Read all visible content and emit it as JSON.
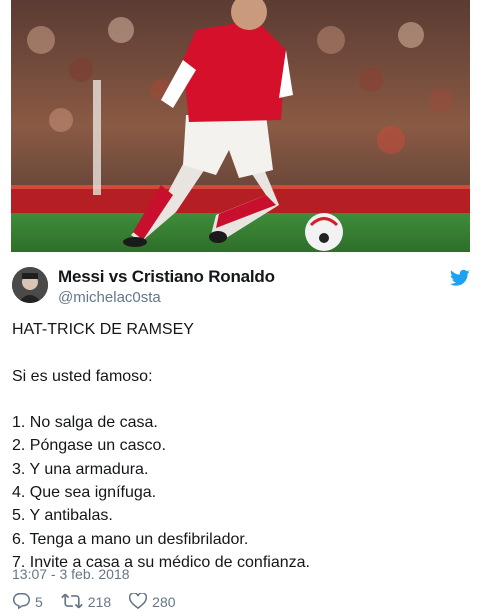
{
  "media": {
    "alt_icon": "photo-soccer-player-icon"
  },
  "tweet": {
    "author_name": "Messi vs Cristiano Ronaldo",
    "author_handle": "@michelac0sta",
    "lines": [
      "HAT-TRICK DE RAMSEY",
      "",
      "Si es usted famoso:",
      "",
      "1. No salga de casa.",
      "2. Póngase un casco.",
      "3. Y una armadura.",
      "4. Que sea ignífuga.",
      "5. Y antibalas.",
      "6. Tenga a mano un desfibrilador.",
      "7. Invite a casa a su médico de confianza."
    ],
    "timestamp": "13:07 - 3 feb. 2018",
    "replies": "5",
    "retweets": "218",
    "likes": "280"
  },
  "colors": {
    "brand": "#1da1f2",
    "meta": "#657786",
    "text": "#14171a"
  }
}
